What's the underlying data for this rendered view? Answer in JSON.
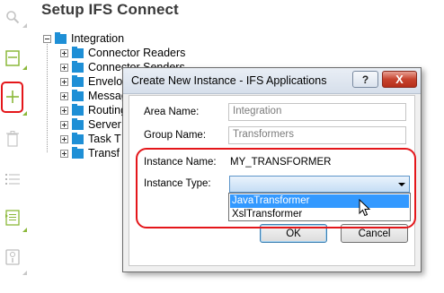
{
  "page": {
    "title": "Setup IFS Connect"
  },
  "toolbar": {
    "buttons": [
      {
        "icon": "search-icon"
      },
      {
        "icon": "form-icon"
      },
      {
        "icon": "add-icon"
      },
      {
        "icon": "delete-icon"
      },
      {
        "icon": "list-icon"
      },
      {
        "icon": "details-icon"
      },
      {
        "icon": "info-icon"
      }
    ],
    "highlight_color": "#e4161a",
    "accent_color": "#8bb83a"
  },
  "tree": {
    "root": {
      "label": "Integration",
      "expanded": true
    },
    "children": [
      {
        "label": "Connector Readers"
      },
      {
        "label": "Connector Senders"
      },
      {
        "label": "Envelopes"
      },
      {
        "label": "Message"
      },
      {
        "label": "Routing"
      },
      {
        "label": "Server"
      },
      {
        "label": "Task T"
      },
      {
        "label": "Transf"
      }
    ],
    "folder_color": "#1e8fd6"
  },
  "dialog": {
    "title": "Create New Instance - IFS Applications",
    "help_label": "?",
    "close_label": "X",
    "fields": {
      "area_name": {
        "label": "Area Name:",
        "value": "Integration"
      },
      "group_name": {
        "label": "Group Name:",
        "value": "Transformers"
      },
      "instance_name": {
        "label": "Instance Name:",
        "value": "MY_TRANSFORMER"
      },
      "instance_type": {
        "label": "Instance Type:",
        "value": "",
        "options": [
          "JavaTransformer",
          "XslTransformer"
        ],
        "highlighted_option": "JavaTransformer"
      }
    },
    "buttons": {
      "ok": "OK",
      "cancel": "Cancel"
    }
  }
}
